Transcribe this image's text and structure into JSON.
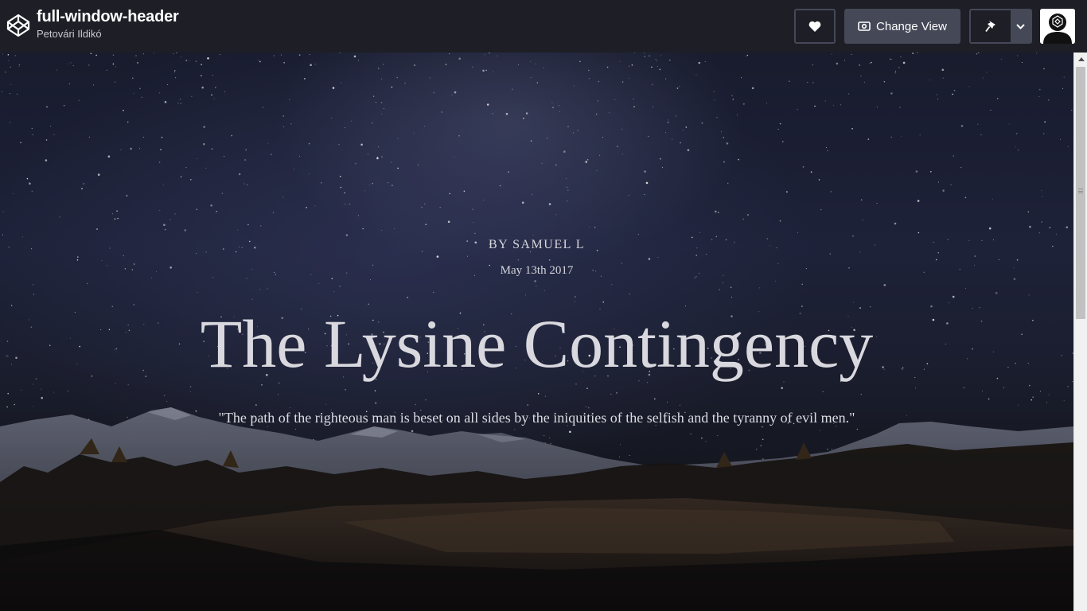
{
  "header": {
    "pen_title": "full-window-header",
    "author": "Petovári Ildikó",
    "logo_icon": "codepen-logo-icon",
    "like_icon": "heart-icon",
    "change_view_label": "Change View",
    "change_view_icon": "eye-icon",
    "pin_icon": "pin-icon",
    "dropdown_icon": "chevron-down-icon",
    "avatar_icon": "user-avatar-icon"
  },
  "preview": {
    "byline": "BY SAMUEL L",
    "date": "May 13th 2017",
    "headline": "The Lysine Contingency",
    "quote": "\"The path of the righteous man is beset on all sides by the iniquities of the selfish and the tyranny of evil men.\""
  },
  "colors": {
    "topbar_bg": "#1e1f26",
    "button_bg": "#444857",
    "text_light": "#d8d8de"
  }
}
